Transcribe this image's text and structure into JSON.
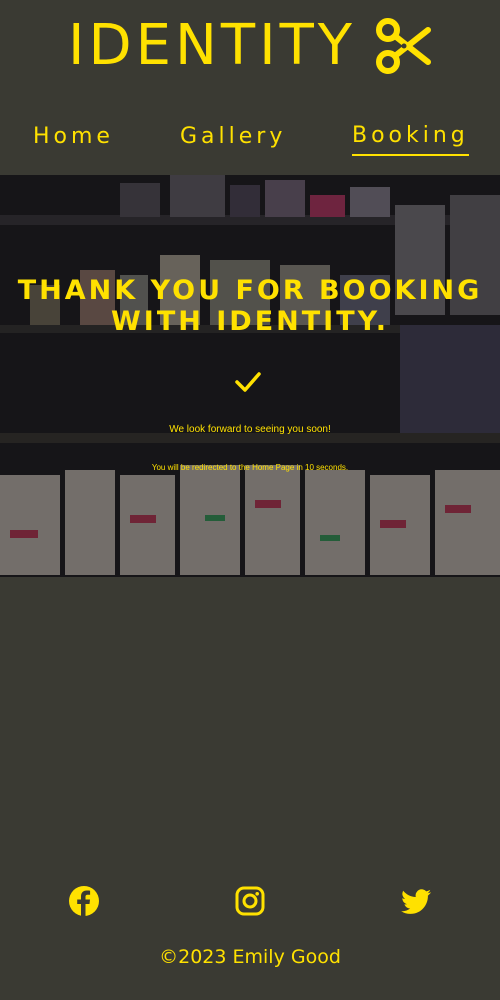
{
  "brand": {
    "name": "IDENTITY",
    "accent_color": "#ffe100",
    "background_color": "#3a3a33",
    "logo_icon": "scissors-icon"
  },
  "nav": {
    "items": [
      {
        "label": "Home",
        "active": false
      },
      {
        "label": "Gallery",
        "active": false
      },
      {
        "label": "Booking",
        "active": true
      }
    ]
  },
  "hero": {
    "title_line1": "THANK YOU FOR BOOKING",
    "title_line2": "WITH IDENTITY.",
    "icon": "checkmark-icon",
    "message": "We look forward to seeing you soon!",
    "redirect_text": "You will be redirected to the Home Page in 10 seconds."
  },
  "footer": {
    "social": [
      {
        "name": "facebook-icon"
      },
      {
        "name": "instagram-icon"
      },
      {
        "name": "twitter-icon"
      }
    ],
    "copyright": "©2023 Emily Good"
  }
}
